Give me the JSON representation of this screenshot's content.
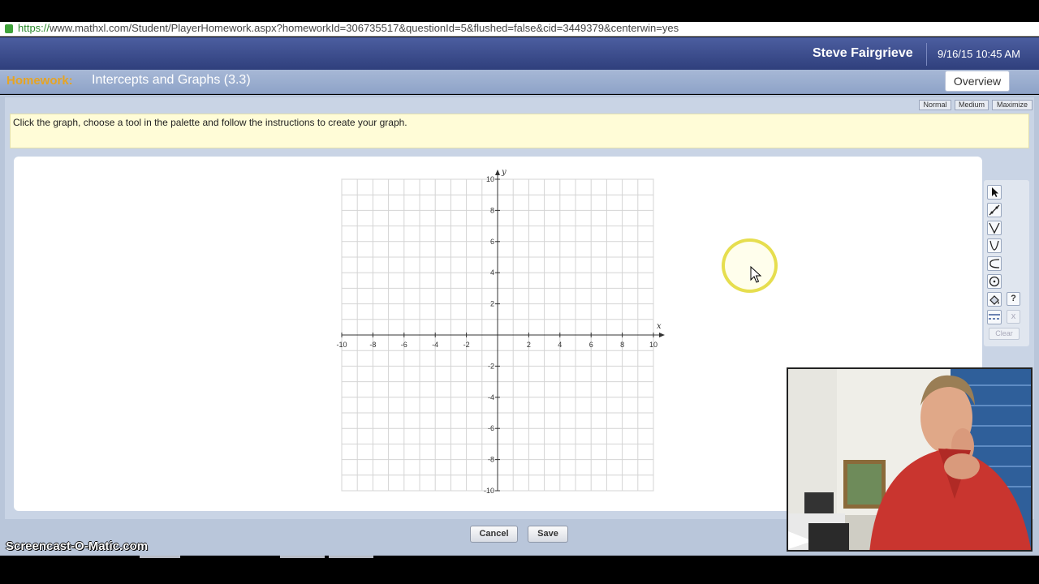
{
  "browser": {
    "url_scheme": "https://",
    "url_rest": "www.mathxl.com/Student/PlayerHomework.aspx?homeworkId=306735517&questionId=5&flushed=false&cid=3449379&centerwin=yes"
  },
  "header": {
    "user_name": "Steve Fairgrieve",
    "datetime": "9/16/15 10:45 AM"
  },
  "homework": {
    "label": "Homework:",
    "title": "Intercepts and Graphs (3.3)",
    "overview_label": "Overview"
  },
  "view_size": {
    "normal": "Normal",
    "medium": "Medium",
    "maximize": "Maximize"
  },
  "instruction": "Click the graph, choose a tool in the palette and follow the instructions to create your graph.",
  "graph": {
    "x_axis_label": "x",
    "y_axis_label": "y",
    "x_min": -10,
    "x_max": 10,
    "y_min": -10,
    "y_max": 10,
    "grid_step": 1,
    "tick_step": 2,
    "x_tick_labels": [
      "-10",
      "-8",
      "-6",
      "-4",
      "-2",
      "2",
      "4",
      "6",
      "8",
      "10"
    ],
    "y_tick_labels": [
      "10",
      "8",
      "6",
      "4",
      "2",
      "-2",
      "-4",
      "-6",
      "-8",
      "-10"
    ]
  },
  "palette": {
    "tools": [
      "pointer-icon",
      "line-icon",
      "absolute-value-icon",
      "parabola-icon",
      "exponential-icon",
      "circle-icon",
      "fill-icon",
      "dashed-line-icon"
    ],
    "help_label": "?",
    "delete_label": "x",
    "clear_label": "Clear"
  },
  "buttons": {
    "cancel": "Cancel",
    "save": "Save"
  },
  "watermark": "Screencast-O-Matic.com",
  "colors": {
    "header_blue": "#2f3f7c",
    "homework_orange": "#e6a424",
    "instruction_yellow": "#fffcd7",
    "cursor_halo": "#e6de4f"
  }
}
